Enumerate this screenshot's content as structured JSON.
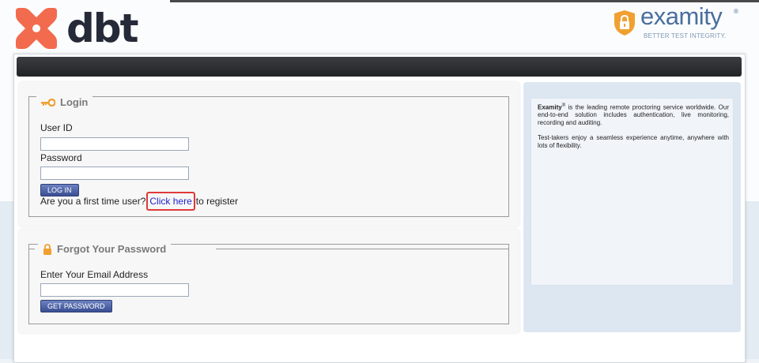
{
  "header": {
    "dbt_logo_text": "dbt",
    "examity_logo_text": "examity",
    "examity_reg": "®",
    "examity_tagline": "BETTER TEST INTEGRITY."
  },
  "login": {
    "legend": "Login",
    "user_id_label": "User ID",
    "user_id_value": "",
    "password_label": "Password",
    "password_value": "",
    "login_button": "LOG IN",
    "register_prefix": "Are you a first time user?",
    "register_link": "Click here",
    "register_suffix": "to register"
  },
  "forgot": {
    "legend": "Forgot Your Password",
    "email_label": "Enter Your Email Address",
    "email_value": "",
    "submit_button": "GET PASSWORD"
  },
  "info": {
    "brand": "Examity",
    "brand_reg": "®",
    "paragraph1_rest": " is the leading remote proctoring service worldwide. Our end-to-end solution includes authentication, live monitoring, recording and auditing.",
    "paragraph2": "Test-takers enjoy a seamless experience anytime, anywhere with lots of flexibility."
  },
  "colors": {
    "dbt_orange": "#f26b4e",
    "examity_blue": "#4a6f9e",
    "examity_gold": "#f0a030",
    "button_blue": "#3a4f93",
    "highlight_red": "#e03a3a",
    "link_blue": "#2222cc"
  },
  "icons": {
    "login_legend": "key-icon",
    "forgot_legend": "lock-icon",
    "examity_mark": "shield-lock-icon",
    "dbt_mark": "dbt-x-icon"
  }
}
